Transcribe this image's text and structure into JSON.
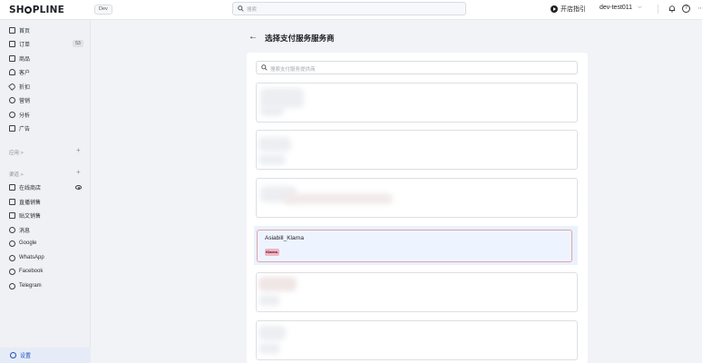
{
  "brand": {
    "logo_left": "SH",
    "logo_right": "PLINE",
    "env": "Dev"
  },
  "topbar": {
    "search_placeholder": "搜索",
    "guide_label": "开店指引",
    "store_name": "dev-test011"
  },
  "sidebar": {
    "items": [
      {
        "label": "首页",
        "icon": "home-icon"
      },
      {
        "label": "订单",
        "icon": "order-icon",
        "count": "53"
      },
      {
        "label": "商品",
        "icon": "product-icon"
      },
      {
        "label": "客户",
        "icon": "customer-icon"
      },
      {
        "label": "折扣",
        "icon": "discount-icon"
      },
      {
        "label": "营销",
        "icon": "marketing-icon"
      },
      {
        "label": "分析",
        "icon": "analytics-icon"
      },
      {
        "label": "广告",
        "icon": "ads-icon"
      }
    ],
    "apps_section": "应用 >",
    "channels_section": "渠道 >",
    "channels": [
      {
        "label": "在线商店",
        "icon": "store-icon"
      },
      {
        "label": "直播销售",
        "icon": "live-icon"
      },
      {
        "label": "贴文销售",
        "icon": "post-icon"
      },
      {
        "label": "消息",
        "icon": "message-icon"
      },
      {
        "label": "Google",
        "icon": "google-icon"
      },
      {
        "label": "WhatsApp",
        "icon": "whatsapp-icon"
      },
      {
        "label": "Facebook",
        "icon": "facebook-icon"
      },
      {
        "label": "Telegram",
        "icon": "telegram-icon"
      }
    ],
    "settings_label": "设置"
  },
  "main": {
    "title": "选择支付服务服务商",
    "search_placeholder": "搜索支付服务提供商",
    "selected_provider": {
      "name": "Asiabill_Klarna",
      "badge": "Klarna."
    }
  },
  "colors": {
    "accent": "#1f4fbf",
    "selected_border": "#e2a3ac",
    "klarna_pink": "#f7b3c2"
  }
}
